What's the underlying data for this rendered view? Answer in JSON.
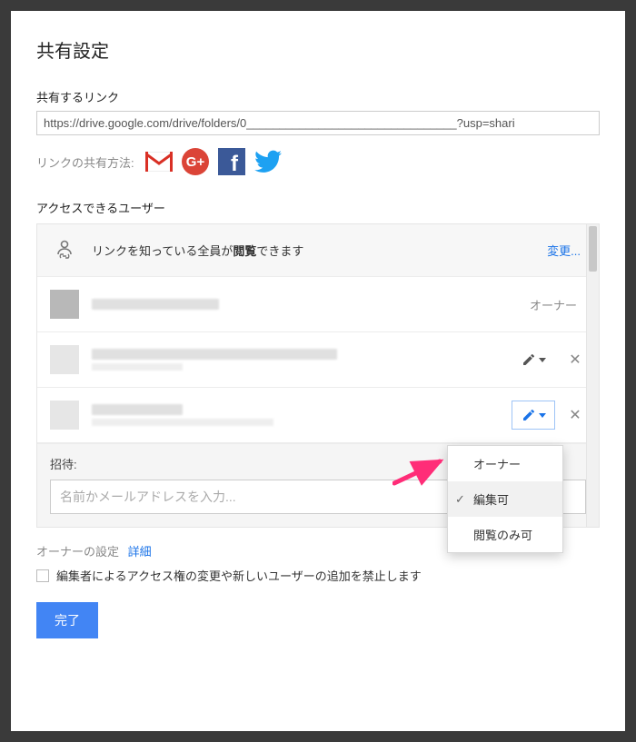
{
  "dialog": {
    "title": "共有設定",
    "share_link_label": "共有するリンク",
    "share_link_value": "https://drive.google.com/drive/folders/0________________________________?usp=shari",
    "share_method_label": "リンクの共有方法:",
    "access_label": "アクセスできるユーザー",
    "link_access_prefix": "リンクを知っている全員が",
    "link_access_bold": "閲覧",
    "link_access_suffix": "できます",
    "change_link": "変更...",
    "owner_role": "オーナー",
    "invite_label": "招待:",
    "invite_placeholder": "名前かメールアドレスを入力...",
    "owner_settings_label": "オーナーの設定",
    "owner_settings_more": "詳細",
    "restrict_editors_label": "編集者によるアクセス権の変更や新しいユーザーの追加を禁止します",
    "done_button": "完了"
  },
  "dropdown": {
    "items": [
      {
        "label": "オーナー",
        "selected": false
      },
      {
        "label": "編集可",
        "selected": true
      },
      {
        "label": "閲覧のみ可",
        "selected": false
      }
    ]
  },
  "icons": {
    "gmail": "gmail-icon",
    "gplus": "google-plus-icon",
    "facebook": "facebook-icon",
    "twitter": "twitter-icon"
  }
}
